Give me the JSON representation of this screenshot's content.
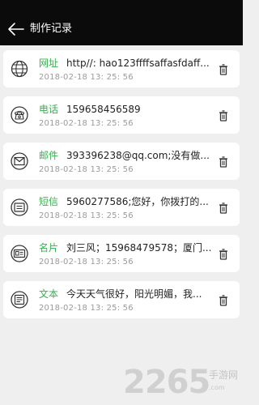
{
  "header": {
    "title": "制作记录"
  },
  "records": [
    {
      "type": "网址",
      "content": "http//:  hao123ffffsaffasfdaff...",
      "time": "2018-02-18  13: 25: 56",
      "icon": "globe-icon"
    },
    {
      "type": "电话",
      "content": "159658456589",
      "time": "2018-02-18  13: 25: 56",
      "icon": "telephone-icon"
    },
    {
      "type": "邮件",
      "content": "393396238@qq.com;没有做...",
      "time": "2018-02-18  13: 25: 56",
      "icon": "envelope-icon"
    },
    {
      "type": "短信",
      "content": "5960277586;您好，你拨打的...",
      "time": "2018-02-18  13: 25: 56",
      "icon": "sms-icon"
    },
    {
      "type": "名片",
      "content": "刘三风；15968479578；厦门...",
      "time": "2018-02-18  13: 25: 56",
      "icon": "business-card-icon"
    },
    {
      "type": "文本",
      "content": "今天天气很好，阳光明媚，我...",
      "time": "2018-02-18  13: 25: 56",
      "icon": "text-icon"
    }
  ],
  "watermark": {
    "brand": "2265",
    "site_name": "手游网",
    "url": ".com"
  },
  "colors": {
    "header_bg": "#0b0b0b",
    "accent": "#33b34b",
    "background": "#efefef"
  }
}
